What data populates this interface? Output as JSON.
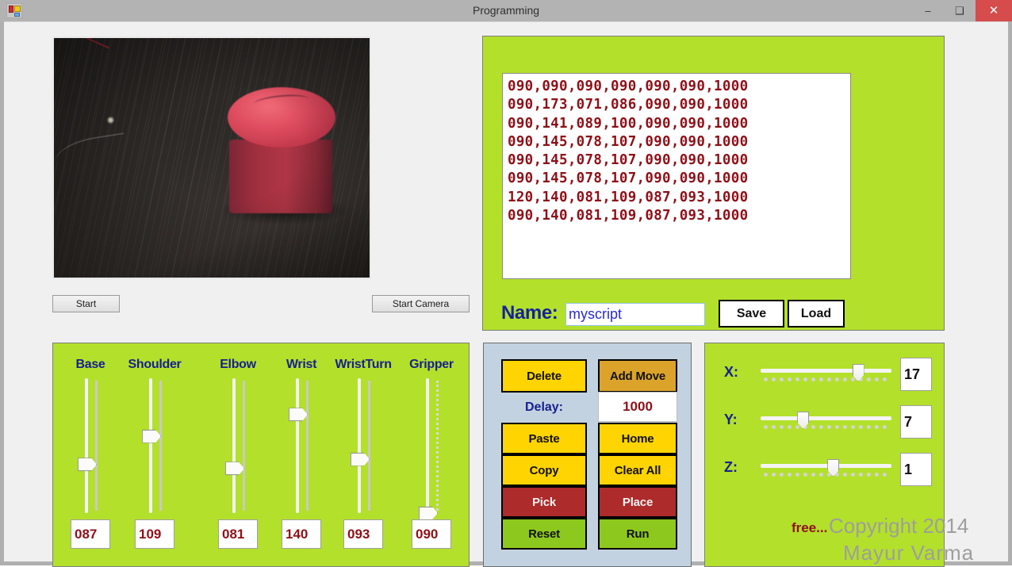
{
  "window": {
    "title": "Programming",
    "icon": "form-designer-icon",
    "minimize": "–",
    "maximize": "❑",
    "close": "✕"
  },
  "camera": {
    "region_name": "camera-preview",
    "scene": "red cylindrical object on dark wooden table",
    "start_label": "Start",
    "start_camera_label": "Start Camera"
  },
  "script": {
    "lines": [
      "090,090,090,090,090,090,1000",
      "090,173,071,086,090,090,1000",
      "090,141,089,100,090,090,1000",
      "090,145,078,107,090,090,1000",
      "090,145,078,107,090,090,1000",
      "090,145,078,107,090,090,1000",
      "120,140,081,109,087,093,1000",
      "090,140,081,109,087,093,1000"
    ],
    "name_label": "Name:",
    "name_value": "myscript",
    "name_placeholder": "",
    "save_label": "Save",
    "load_label": "Load",
    "text_color": "#8e1018",
    "panel_color": "#b3e02b"
  },
  "joints": [
    {
      "label": "Base",
      "value": "087",
      "thumb_pct": 59,
      "ticks": "solid"
    },
    {
      "label": "Shoulder",
      "value": "109",
      "thumb_pct": 38,
      "ticks": "solid"
    },
    {
      "label": "Elbow",
      "value": "081",
      "thumb_pct": 62,
      "ticks": "solid"
    },
    {
      "label": "Wrist",
      "value": "140",
      "thumb_pct": 22,
      "ticks": "solid"
    },
    {
      "label": "WristTurn",
      "value": "093",
      "thumb_pct": 55,
      "ticks": "solid"
    },
    {
      "label": "Gripper",
      "value": "090",
      "thumb_pct": 95,
      "ticks": "dotted"
    }
  ],
  "actions": {
    "delete_label": "Delete",
    "add_move_label": "Add Move",
    "delay_label": "Delay:",
    "delay_value": "1000",
    "paste_label": "Paste",
    "home_label": "Home",
    "copy_label": "Copy",
    "clear_all_label": "Clear All",
    "pick_label": "Pick",
    "place_label": "Place",
    "reset_label": "Reset",
    "run_label": "Run",
    "colors": {
      "yellow": "#ffd400",
      "gold": "#dba32a",
      "red": "#ad2b2b",
      "green": "#8dc81e",
      "panel": "#c3d2e0"
    }
  },
  "xyz": {
    "axes": [
      {
        "label": "X:",
        "value": "17",
        "thumb_pct": 70
      },
      {
        "label": "Y:",
        "value": "7",
        "thumb_pct": 28
      },
      {
        "label": "Z:",
        "value": "1",
        "thumb_pct": 51
      }
    ],
    "free_text": "free...",
    "watermark_line1": "Copyright 2014",
    "watermark_line2": "Mayur Varma"
  }
}
